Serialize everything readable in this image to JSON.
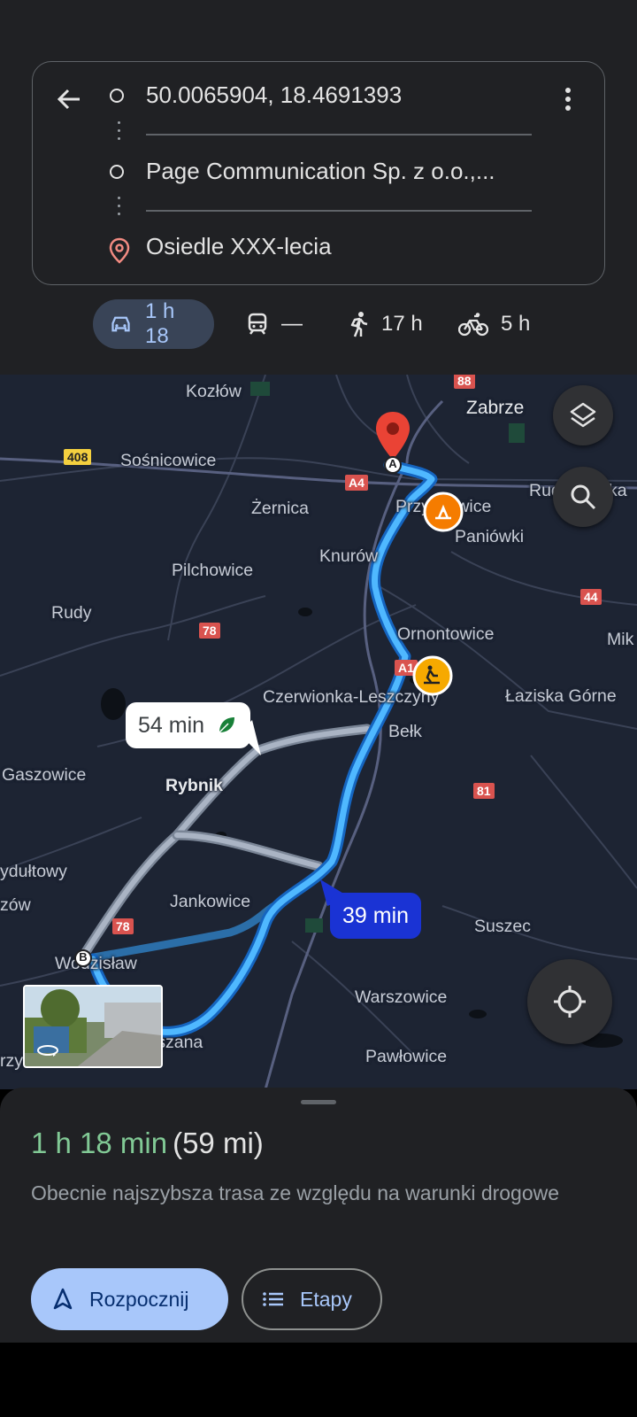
{
  "directions": {
    "origin": "50.0065904, 18.4691393",
    "waypoint": "Page Communication Sp. z o.o.,...",
    "destination": "Osiedle XXX-lecia"
  },
  "modes": [
    {
      "name": "car",
      "label": "1 h 18",
      "active": true
    },
    {
      "name": "transit",
      "label": "—",
      "active": false
    },
    {
      "name": "walk",
      "label": "17 h",
      "active": false
    },
    {
      "name": "bike",
      "label": "5 h",
      "active": false
    }
  ],
  "map": {
    "places": {
      "kozlow": "Kozłów",
      "zabrze": "Zabrze",
      "sosnicowice": "Sośnicowice",
      "zernica": "Żernica",
      "przyszowice": "Przyszowice",
      "ruda": "Ruda Śląska",
      "paniowki": "Paniówki",
      "pilchowice": "Pilchowice",
      "knurow": "Knurów",
      "rudy": "Rudy",
      "ornontowice": "Ornontowice",
      "mik": "Mik",
      "czerwionka": "Czerwionka-Leszczyny",
      "laziska": "Łaziska Górne",
      "belk": "Bełk",
      "gaszowice": "Gaszowice",
      "rybnik": "Rybnik",
      "pszow": "ydułtowy",
      "zow": "zów",
      "jankowice": "Jankowice",
      "suszec": "Suszec",
      "wodzislaw": "Wodzisław",
      "warszowice": "Warszowice",
      "mszana": "Mszana",
      "pawlowice": "Pawłowice",
      "rzyce": "rzyce"
    },
    "shields": {
      "r88": "88",
      "r408": "408",
      "a4": "A4",
      "r44": "44",
      "r78a": "78",
      "a1": "A1",
      "r81": "81",
      "r78b": "78"
    },
    "route_labels": {
      "alt": "54 min",
      "main": "39 min"
    },
    "markers": {
      "a": "A",
      "b": "B"
    },
    "colors": {
      "main_route": "#4fb8ff",
      "alt_route": "#9aa6b8",
      "bubble_main": "#1a33d4",
      "pin": "#ea4335",
      "warning": "#f6a900"
    }
  },
  "sheet": {
    "time": "1 h 18 min",
    "distance": "(59 mi)",
    "description": "Obecnie najszybsza trasa ze względu na warunki drogowe",
    "start_label": "Rozpocznij",
    "steps_label": "Etapy"
  }
}
